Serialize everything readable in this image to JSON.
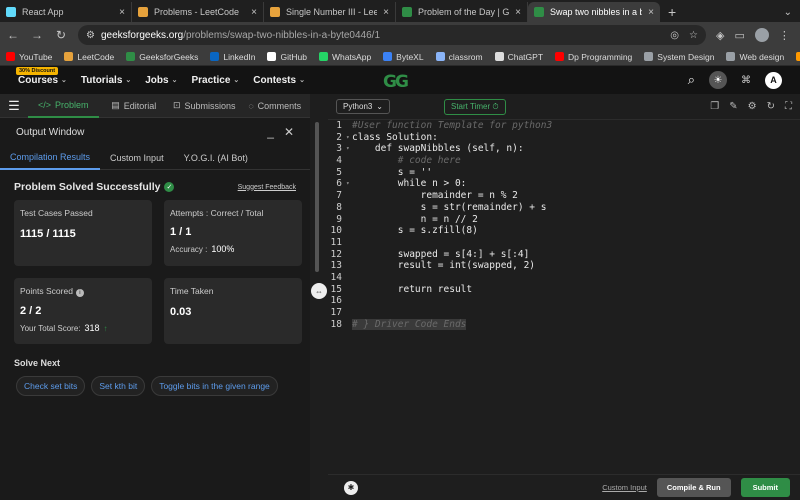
{
  "browser": {
    "tabs": [
      {
        "title": "React App",
        "active": false,
        "color": "#61dafb"
      },
      {
        "title": "Problems - LeetCode",
        "active": false,
        "color": "#e6a23c"
      },
      {
        "title": "Single Number III - LeetCode",
        "active": false,
        "color": "#e6a23c"
      },
      {
        "title": "Problem of the Day | GeeksforG",
        "active": false,
        "color": "#2f8d46"
      },
      {
        "title": "Swap two nibbles in a byte | P",
        "active": true,
        "color": "#2f8d46"
      }
    ],
    "newtab": "+",
    "close": "×",
    "url_host": "geeksforgeeks.org",
    "url_path": "/problems/swap-two-nibbles-in-a-byte0446/1",
    "bookmarks": [
      {
        "label": "YouTube",
        "color": "#ff0000"
      },
      {
        "label": "LeetCode",
        "color": "#e6a23c"
      },
      {
        "label": "GeeksforGeeks",
        "color": "#2f8d46"
      },
      {
        "label": "LinkedIn",
        "color": "#0a66c2"
      },
      {
        "label": "GitHub",
        "color": "#ffffff"
      },
      {
        "label": "WhatsApp",
        "color": "#25d366"
      },
      {
        "label": "ByteXL",
        "color": "#3b82f6"
      },
      {
        "label": "classrom",
        "color": "#8ab4f8"
      },
      {
        "label": "ChatGPT",
        "color": "#dddddd"
      },
      {
        "label": "Dp Programming",
        "color": "#ff0000"
      },
      {
        "label": "System Design",
        "color": "#9aa0a6"
      },
      {
        "label": "Web design",
        "color": "#9aa0a6"
      },
      {
        "label": "AWS",
        "color": "#ff9900"
      }
    ]
  },
  "site": {
    "discount": "30% Discount",
    "nav": [
      "Courses",
      "Tutorials",
      "Jobs",
      "Practice",
      "Contests"
    ],
    "logo": "GG",
    "avatar": "A"
  },
  "problem_tabs": [
    {
      "label": "Problem",
      "active": true
    },
    {
      "label": "Editorial",
      "active": false
    },
    {
      "label": "Submissions",
      "active": false
    },
    {
      "label": "Comments",
      "active": false
    }
  ],
  "output": {
    "title": "Output Window",
    "tabs": [
      "Compilation Results",
      "Custom Input",
      "Y.O.G.I. (AI Bot)"
    ],
    "status": "Problem Solved Successfully",
    "feedback": "Suggest Feedback",
    "cards": {
      "test_label": "Test Cases Passed",
      "test_value": "1115 / 1115",
      "attempts_label": "Attempts : Correct / Total",
      "attempts_value": "1 / 1",
      "accuracy_label": "Accuracy :",
      "accuracy_value": "100%",
      "points_label": "Points Scored",
      "points_value": "2 / 2",
      "total_label": "Your Total Score:",
      "total_value": "318",
      "time_label": "Time Taken",
      "time_value": "0.03"
    },
    "solve_next": "Solve Next",
    "chips": [
      "Check set bits",
      "Set kth bit",
      "Toggle bits in the given range"
    ]
  },
  "editor": {
    "language": "Python3",
    "timer": "Start Timer",
    "lines": [
      {
        "n": "1",
        "t": "#User function Template for python3",
        "c": "comment"
      },
      {
        "n": "2",
        "t": "class Solution:",
        "c": ""
      },
      {
        "n": "3",
        "t": "    def swapNibbles (self, n):",
        "c": ""
      },
      {
        "n": "4",
        "t": "        # code here",
        "c": "comment"
      },
      {
        "n": "5",
        "t": "        s = ''",
        "c": ""
      },
      {
        "n": "6",
        "t": "        while n > 0:",
        "c": ""
      },
      {
        "n": "7",
        "t": "            remainder = n % 2",
        "c": ""
      },
      {
        "n": "8",
        "t": "            s = str(remainder) + s",
        "c": ""
      },
      {
        "n": "9",
        "t": "            n = n // 2",
        "c": ""
      },
      {
        "n": "10",
        "t": "        s = s.zfill(8)",
        "c": ""
      },
      {
        "n": "11",
        "t": "",
        "c": ""
      },
      {
        "n": "12",
        "t": "        swapped = s[4:] + s[:4]",
        "c": ""
      },
      {
        "n": "13",
        "t": "        result = int(swapped, 2)",
        "c": ""
      },
      {
        "n": "14",
        "t": "",
        "c": ""
      },
      {
        "n": "15",
        "t": "        return result",
        "c": ""
      },
      {
        "n": "16",
        "t": "",
        "c": ""
      },
      {
        "n": "17",
        "t": "",
        "c": ""
      },
      {
        "n": "18",
        "t": "# } Driver Code Ends",
        "c": "fold"
      }
    ],
    "custom_input": "Custom Input",
    "compile": "Compile & Run",
    "submit": "Submit"
  }
}
